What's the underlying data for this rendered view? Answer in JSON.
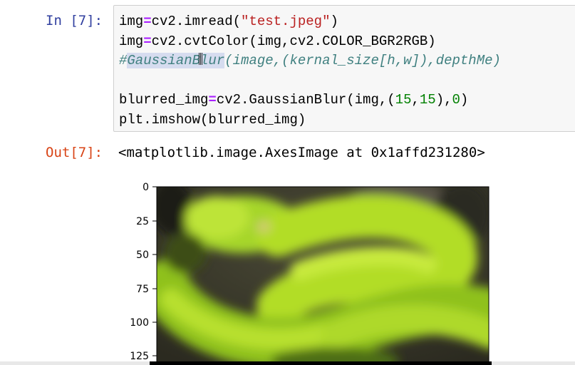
{
  "cell_input": {
    "prompt": "In [7]:",
    "lines": [
      "img=cv2.imread(\"test.jpeg\")",
      "img=cv2.cvtColor(img,cv2.COLOR_BGR2RGB)",
      "#GaussianBlur(image,(kernal_size[h,w]),depthMe)",
      "",
      "blurred_img=cv2.GaussianBlur(img,(15,15),0)",
      "plt.imshow(blurred_img)"
    ]
  },
  "cell_output": {
    "prompt": "Out[7]:",
    "text": "<matplotlib.image.AxesImage at 0x1affd231280>"
  },
  "plot": {
    "y_ticks": [
      "0",
      "25",
      "50",
      "75",
      "100",
      "125"
    ],
    "content": "Blurred image of a green snake"
  },
  "colors": {
    "in_prompt": "#303f9f",
    "out_prompt": "#d84315",
    "keyword_op": "#aa22ff",
    "string": "#ba2121",
    "number": "#008000",
    "comment": "#408080"
  }
}
